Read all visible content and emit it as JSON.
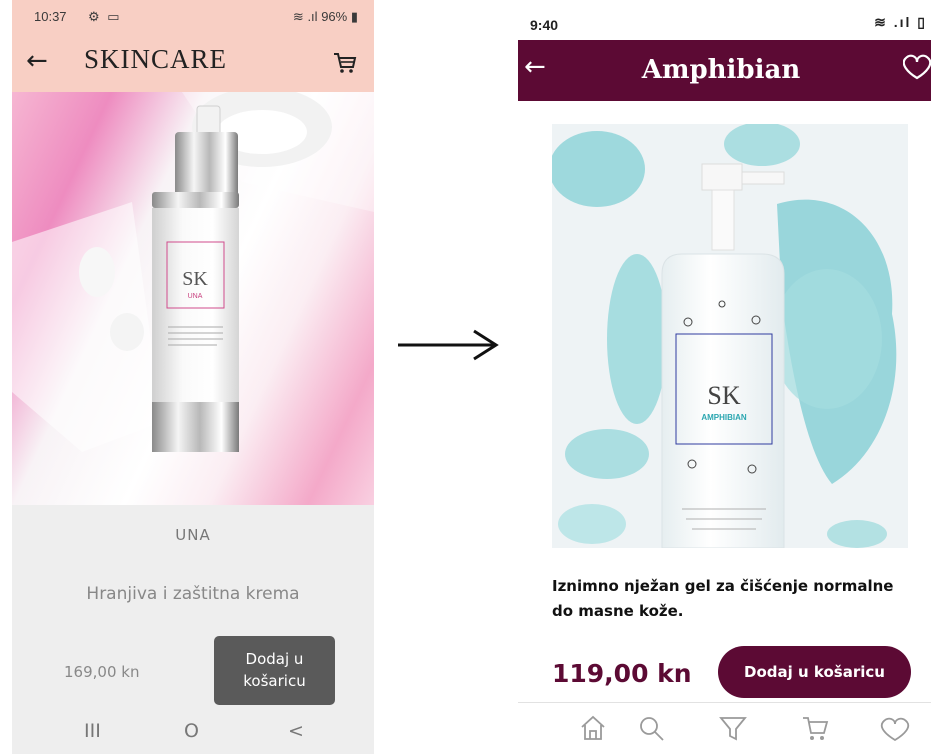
{
  "left": {
    "status": {
      "time": "10:37",
      "battery": "96%"
    },
    "title": "SKINCARE",
    "product": {
      "label_logo": "SK",
      "label_name": "UNA",
      "name": "UNA",
      "description": "Hranjiva i zaštitna krema",
      "price": "169,00 kn",
      "add_button_line1": "Dodaj u",
      "add_button_line2": "košaricu"
    },
    "nav": {
      "recents": "III",
      "home": "O",
      "back": "<"
    }
  },
  "right": {
    "status": {
      "time": "9:40"
    },
    "title": "Amphibian",
    "product": {
      "label_logo": "SK",
      "label_name": "AMPHIBIAN",
      "description": "Iznimno nježan gel za čišćenje normalne do masne kože.",
      "price": "119,00 kn",
      "add_button": "Dodaj u košaricu"
    },
    "nav_items": [
      "home-icon",
      "search-icon",
      "filter-icon",
      "cart-icon",
      "heart-icon"
    ]
  },
  "colors": {
    "left_header": "#f8cfc4",
    "left_button": "#5a5a5a",
    "right_brand": "#5c0a34",
    "aqua": "#8fd3d8"
  }
}
